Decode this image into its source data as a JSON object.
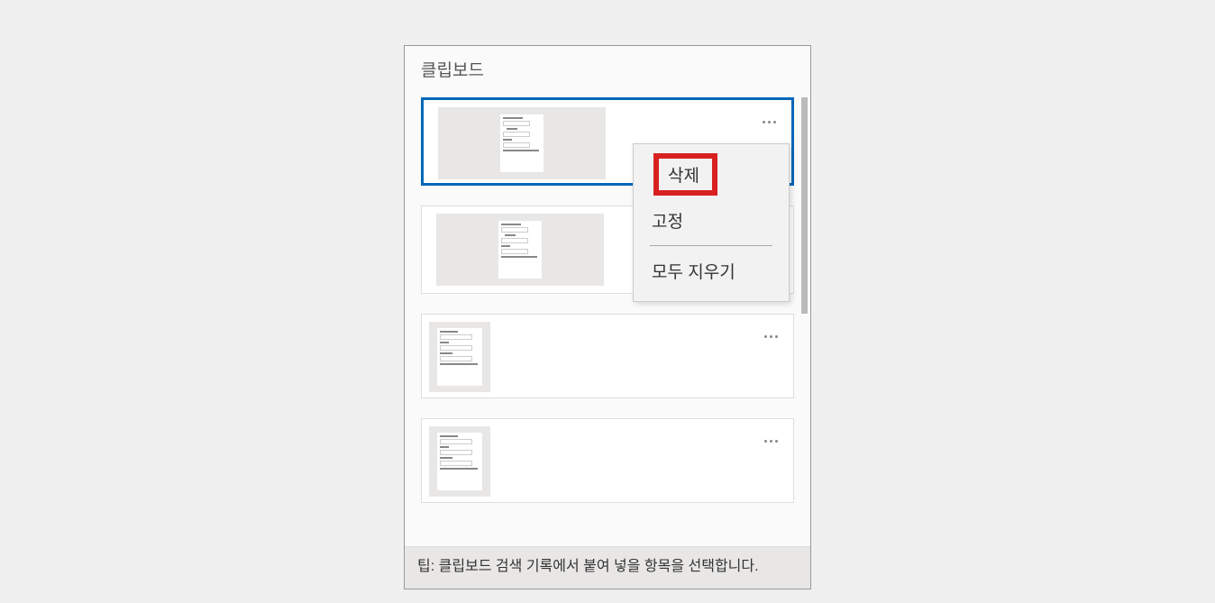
{
  "panel": {
    "title": "클립보드"
  },
  "items": [
    {
      "selected": true,
      "thumbStyle": "wide"
    },
    {
      "selected": false,
      "thumbStyle": "wide"
    },
    {
      "selected": false,
      "thumbStyle": "narrow"
    },
    {
      "selected": false,
      "thumbStyle": "narrow"
    }
  ],
  "contextMenu": {
    "delete": "삭제",
    "pin": "고정",
    "clearAll": "모두 지우기"
  },
  "footer": {
    "tip": "팁: 클립보드 검색 기록에서 붙여 넣을 항목을 선택합니다."
  }
}
